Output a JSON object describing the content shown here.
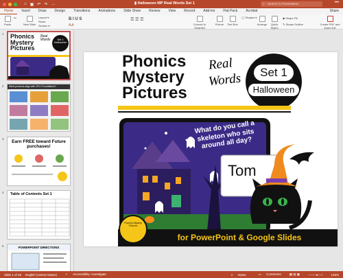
{
  "window": {
    "title": "Halloween MP Real Words Set 1",
    "search_placeholder": "Search in Presentation",
    "share_label": "Share"
  },
  "ribbon_tabs": [
    "Home",
    "Insert",
    "Draw",
    "Design",
    "Transitions",
    "Animations",
    "Slide Show",
    "Review",
    "View",
    "Record",
    "Add-ins",
    "Flat Pack",
    "Acrobat"
  ],
  "ribbon": {
    "paste": "Paste",
    "new_slide": "New Slide",
    "layout": "Layout",
    "reset": "Reset",
    "section": "Section",
    "convert_smartart": "Convert to SmartArt",
    "picture": "Picture",
    "text_box": "Text Box",
    "shapes": "Shapes",
    "arrange": "Arrange",
    "quick_styles": "Quick Styles",
    "shape_fill": "Shape Fill",
    "shape_outline": "Shape Outline",
    "create_pdf": "Create PDF and share link"
  },
  "thumbnails": [
    {
      "num": "1",
      "title_lines": [
        "Phonics",
        "Mystery",
        "Pictures"
      ],
      "side": "Real Words",
      "badge": "Set 1 Halloween"
    },
    {
      "num": "2",
      "title": "What products align with UFLI Foundations?"
    },
    {
      "num": "3",
      "title": "Earn FREE toward Future purchases!"
    },
    {
      "num": "4",
      "title": "Table of Contents Set 1"
    },
    {
      "num": "5",
      "title": "POWERPOINT DIRECTIONS"
    }
  ],
  "slide": {
    "title_lines": [
      "Phonics",
      "Mystery",
      "Pictures"
    ],
    "real": "Real",
    "words": "Words",
    "badge_top": "Set 1",
    "badge_bottom": "Halloween",
    "riddle": "What do you call a skeleton who sits around all day?",
    "answer_partial": "Tom",
    "footer": "for PowerPoint & Google Slides",
    "stamp": "Phonics Mystery Pictures"
  },
  "status": {
    "slide_info": "Slide 1 of 45",
    "language": "English (United States)",
    "accessibility": "Accessibility: Investigate",
    "notes": "Notes",
    "comments": "Comments",
    "zoom": "146%"
  },
  "colors": {
    "accent": "#b7472a",
    "slide_purple": "#3b2b86",
    "slide_yellow": "#f5c518",
    "cat_green": "#39b54a"
  }
}
